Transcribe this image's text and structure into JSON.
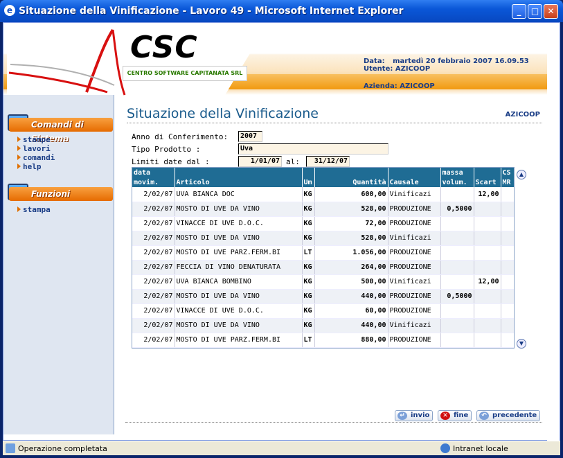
{
  "window": {
    "title": "Situazione della Vinificazione - Lavoro 49 - Microsoft Internet Explorer"
  },
  "header": {
    "logo": "CSC",
    "logo_sub": "CENTRO SOFTWARE CAPITANATA SRL",
    "data_label": "Data:",
    "data_value": "martedì 20 febbraio 2007 16.09.53",
    "utente_label": "Utente:",
    "utente_value": "AZICOOP",
    "azienda_label": "Azienda:",
    "azienda_value": "AZICOOP"
  },
  "sidebar": {
    "section1": "Comandi di Sistema",
    "links1": [
      "stampe",
      "lavori",
      "comandi",
      "help"
    ],
    "section2": "Funzioni",
    "links2": [
      "stampa"
    ]
  },
  "main": {
    "title": "Situazione della Vinificazione",
    "azienda": "AZICOOP",
    "anno_label": "Anno di Conferimento:",
    "anno_value": "2007",
    "tipo_label": "Tipo Prodotto :",
    "tipo_value": "Uva",
    "limiti_label": "Limiti date dal :",
    "dal_value": "1/01/07",
    "al_label": "al:",
    "al_value": "31/12/07"
  },
  "table": {
    "headers_top": [
      "data",
      "",
      "",
      "",
      "",
      "massa",
      "",
      "CS"
    ],
    "headers": [
      "movim.",
      "Articolo",
      "Um",
      "Quantità",
      "Causale",
      "volum.",
      "Scart",
      "MR"
    ],
    "rows": [
      [
        "2/02/07",
        "UVA BIANCA DOC",
        "KG",
        "600,00",
        "Vinificazi",
        "",
        "12,00",
        ""
      ],
      [
        "2/02/07",
        "MOSTO DI UVE DA VINO",
        "KG",
        "528,00",
        "PRODUZIONE",
        "0,5000",
        "",
        ""
      ],
      [
        "2/02/07",
        "VINACCE DI UVE D.O.C.",
        "KG",
        "72,00",
        "PRODUZIONE",
        "",
        "",
        ""
      ],
      [
        "2/02/07",
        "MOSTO DI UVE DA VINO",
        "KG",
        "528,00",
        "Vinificazi",
        "",
        "",
        ""
      ],
      [
        "2/02/07",
        "MOSTO DI UVE PARZ.FERM.BI",
        "LT",
        "1.056,00",
        "PRODUZIONE",
        "",
        "",
        ""
      ],
      [
        "2/02/07",
        "FECCIA DI VINO DENATURATA",
        "KG",
        "264,00",
        "PRODUZIONE",
        "",
        "",
        ""
      ],
      [
        "2/02/07",
        "UVA BIANCA BOMBINO",
        "KG",
        "500,00",
        "Vinificazi",
        "",
        "12,00",
        ""
      ],
      [
        "2/02/07",
        "MOSTO DI UVE DA VINO",
        "KG",
        "440,00",
        "PRODUZIONE",
        "0,5000",
        "",
        ""
      ],
      [
        "2/02/07",
        "VINACCE DI UVE D.O.C.",
        "KG",
        "60,00",
        "PRODUZIONE",
        "",
        "",
        ""
      ],
      [
        "2/02/07",
        "MOSTO DI UVE DA VINO",
        "KG",
        "440,00",
        "Vinificazi",
        "",
        "",
        ""
      ],
      [
        "2/02/07",
        "MOSTO DI UVE PARZ.FERM.BI",
        "LT",
        "880,00",
        "PRODUZIONE",
        "",
        "",
        ""
      ]
    ]
  },
  "buttons": {
    "invio": "invio",
    "fine": "fine",
    "precedente": "precedente"
  },
  "status": {
    "text": "Operazione completata",
    "zone": "Intranet locale"
  },
  "colors": {
    "accent": "#1f6c94",
    "orange": "#f19a10",
    "titlebar": "#0a57d8"
  }
}
